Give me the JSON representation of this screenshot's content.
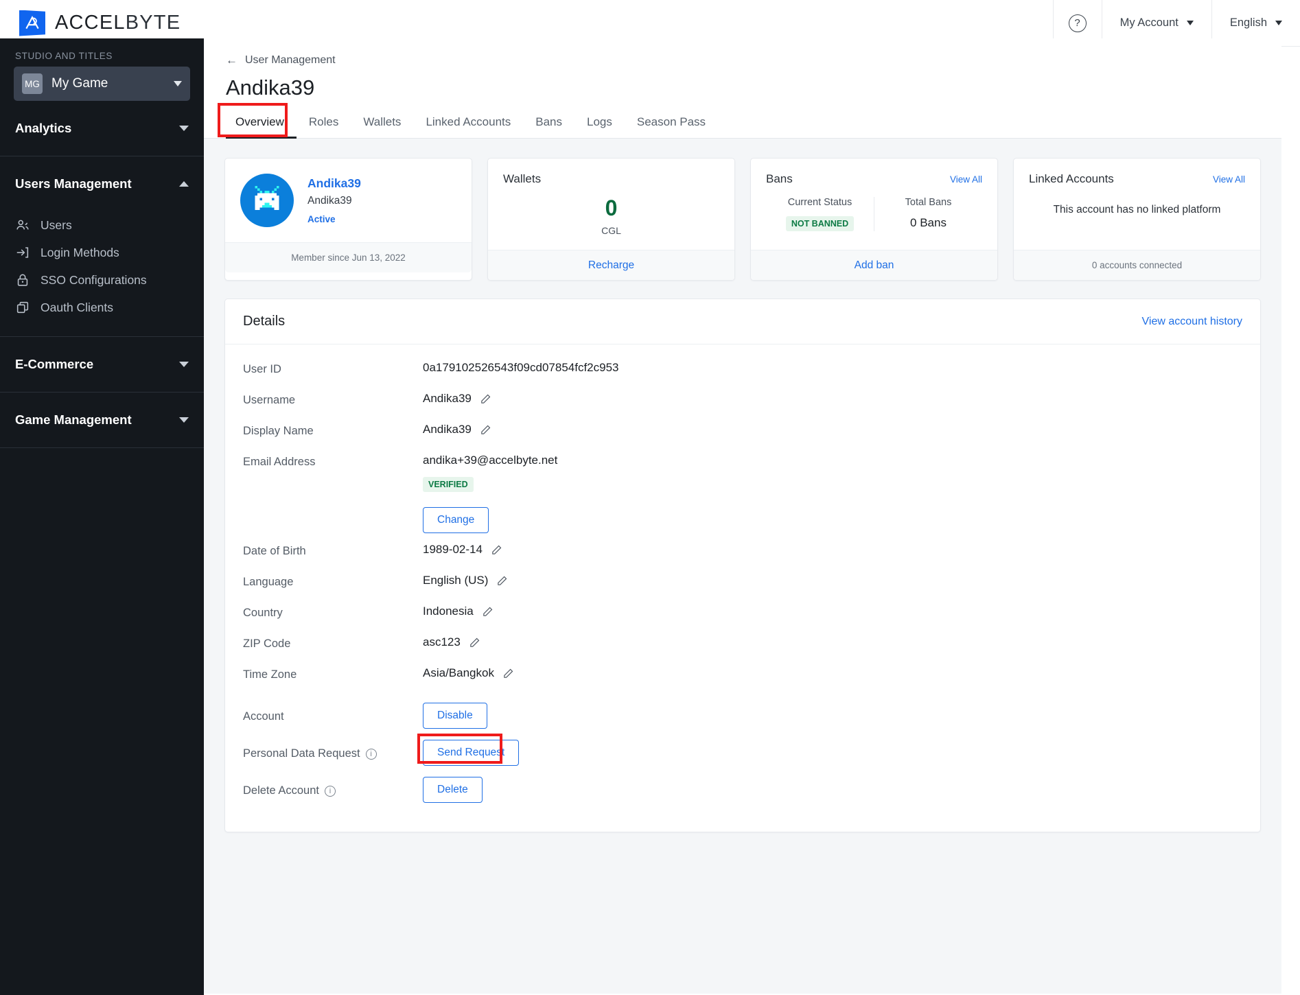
{
  "brand": {
    "name_bold": "ACCEL",
    "name_light": "BYTE",
    "mark": "accelbyte-logo-icon"
  },
  "topbar": {
    "help_icon": "?",
    "account_label": "My Account",
    "language_label": "English"
  },
  "sidebar": {
    "section_label": "STUDIO AND TITLES",
    "game": {
      "badge": "MG",
      "name": "My Game"
    },
    "groups": [
      {
        "title": "Analytics",
        "expanded": false
      },
      {
        "title": "Users Management",
        "expanded": true
      },
      {
        "title": "E-Commerce",
        "expanded": false
      },
      {
        "title": "Game Management",
        "expanded": false
      }
    ],
    "users_items": [
      {
        "label": "Users",
        "icon": "users-icon"
      },
      {
        "label": "Login Methods",
        "icon": "login-icon"
      },
      {
        "label": "SSO Configurations",
        "icon": "lock-icon"
      },
      {
        "label": "Oauth Clients",
        "icon": "copy-icon"
      }
    ]
  },
  "page": {
    "breadcrumb": "User Management",
    "title": "Andika39",
    "tabs": [
      {
        "label": "Overview",
        "active": true
      },
      {
        "label": "Roles",
        "active": false
      },
      {
        "label": "Wallets",
        "active": false
      },
      {
        "label": "Linked Accounts",
        "active": false
      },
      {
        "label": "Bans",
        "active": false
      },
      {
        "label": "Logs",
        "active": false
      },
      {
        "label": "Season Pass",
        "active": false
      }
    ]
  },
  "cards": {
    "profile": {
      "name": "Andika39",
      "display_name": "Andika39",
      "status": "Active",
      "footer": "Member since Jun 13, 2022"
    },
    "wallets": {
      "title": "Wallets",
      "count": "0",
      "currency": "CGL",
      "footer_link": "Recharge"
    },
    "bans": {
      "title": "Bans",
      "view_all": "View All",
      "current_status_label": "Current Status",
      "current_status_value": "NOT BANNED",
      "total_label": "Total Bans",
      "total_value": "0 Bans",
      "footer_link": "Add ban"
    },
    "linked": {
      "title": "Linked Accounts",
      "view_all": "View All",
      "message": "This account has no linked platform",
      "footer": "0 accounts connected"
    }
  },
  "details": {
    "title": "Details",
    "history_link": "View account history",
    "rows": [
      {
        "label": "User ID",
        "value": "0a179102526543f09cd07854fcf2c953",
        "edit": false
      },
      {
        "label": "Username",
        "value": "Andika39",
        "edit": true
      },
      {
        "label": "Display Name",
        "value": "Andika39",
        "edit": true
      },
      {
        "label": "Email Address",
        "value": "andika+39@accelbyte.net",
        "badge": "VERIFIED",
        "button": "Change"
      },
      {
        "label": "Date of Birth",
        "value": "1989-02-14",
        "edit": true
      },
      {
        "label": "Language",
        "value": "English (US)",
        "edit": true
      },
      {
        "label": "Country",
        "value": "Indonesia",
        "edit": true
      },
      {
        "label": "ZIP Code",
        "value": "asc123",
        "edit": true
      },
      {
        "label": "Time Zone",
        "value": "Asia/Bangkok",
        "edit": true
      },
      {
        "label": "Account",
        "button": "Disable"
      },
      {
        "label": "Personal Data Request",
        "info": true,
        "button": "Send Request",
        "highlighted": true
      },
      {
        "label": "Delete Account",
        "info": true,
        "button": "Delete"
      }
    ]
  },
  "colors": {
    "accent": "#1f6fe5",
    "highlight": "#ef1b1b",
    "green": "#0c7a44",
    "sidebar": "#14181d"
  }
}
